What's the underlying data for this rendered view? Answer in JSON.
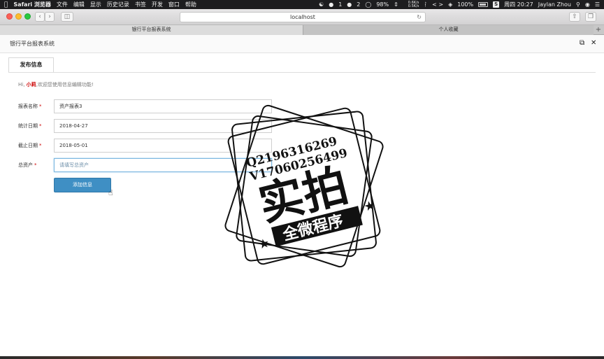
{
  "menubar": {
    "app_name": "Safari 浏览器",
    "items": [
      "文件",
      "编辑",
      "显示",
      "历史记录",
      "书签",
      "开发",
      "窗口",
      "帮助"
    ],
    "qq_count": "1",
    "qq2_count": "2",
    "battery_percent_text": "98%",
    "net_up": "0.6K/s",
    "net_down": "0.5K/s",
    "battery_text": "100%",
    "datetime": "周四 20:27",
    "user": "Jaylan Zhou"
  },
  "browser": {
    "url": "localhost",
    "tabs": [
      {
        "label": "银行平台报表系统",
        "active": true
      },
      {
        "label": "个人收藏",
        "active": false
      }
    ]
  },
  "page": {
    "title": "银行平台报表系统",
    "tab_label": "发布信息",
    "greeting_prefix": "Hi,",
    "username": "小莉",
    "greeting_suffix": ",欢迎您使用信息编辑功能!",
    "fields": [
      {
        "label": "报表名称",
        "value": "资产报表3",
        "placeholder": ""
      },
      {
        "label": "统计日期",
        "value": "2018-04-27",
        "placeholder": ""
      },
      {
        "label": "截止日期",
        "value": "2018-05-01",
        "placeholder": ""
      },
      {
        "label": "总资产",
        "value": "",
        "placeholder": "请填写总资产"
      }
    ],
    "required_mark": "*",
    "submit_label": "添加信息"
  },
  "watermark": {
    "line1": "Q2196316269",
    "line2": "V17060256499",
    "big_text": "实拍",
    "banner_text": "全微程序"
  },
  "colors": {
    "accent": "#3f8fc4",
    "required": "#cc0000"
  }
}
